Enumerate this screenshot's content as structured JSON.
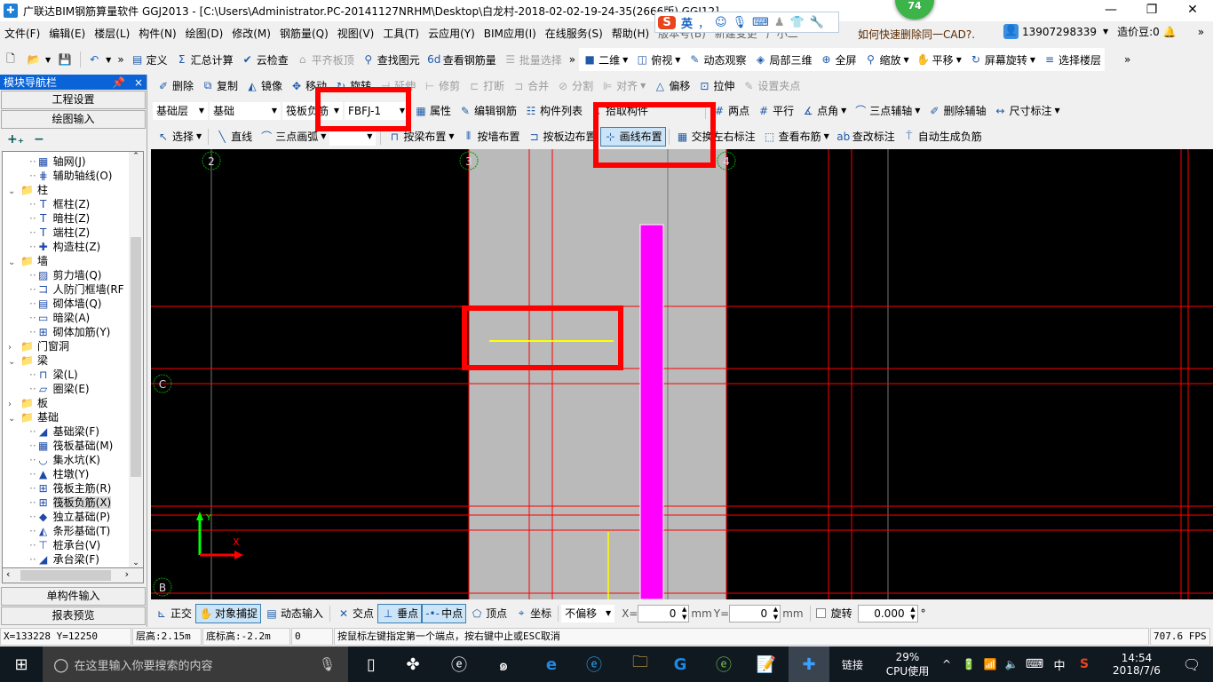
{
  "title": "广联达BIM钢筋算量软件 GGJ2013 - [C:\\Users\\Administrator.PC-20141127NRHM\\Desktop\\白龙村-2018-02-02-19-24-35(2666版).GGJ12]",
  "badge": "74",
  "ime": {
    "lang": "英",
    "punct": "，"
  },
  "menus": [
    "文件(F)",
    "编辑(E)",
    "楼层(L)",
    "构件(N)",
    "绘图(D)",
    "修改(M)",
    "钢筋量(Q)",
    "视图(V)",
    "工具(T)",
    "云应用(Y)",
    "BIM应用(I)",
    "在线服务(S)",
    "帮助(H)",
    "版本号(B)",
    "新建变更",
    "广小二"
  ],
  "tip": "如何快速删除同一CAD?.",
  "user": {
    "phone": "13907298339",
    "beans": "造价豆:0"
  },
  "toolbar1": [
    {
      "label": "定义",
      "icon": "▤"
    },
    {
      "label": "汇总计算",
      "icon": "Σ"
    },
    {
      "label": "云检查",
      "icon": "✔"
    },
    {
      "label": "平齐板顶",
      "icon": "⌂",
      "disabled": true
    },
    {
      "label": "查找图元",
      "icon": "⚲"
    },
    {
      "label": "查看钢筋量",
      "icon": "6d"
    },
    {
      "label": "批量选择",
      "icon": "☰",
      "disabled": true
    }
  ],
  "toolbar1b": [
    {
      "label": "二维",
      "icon": "■",
      "dropdown": true
    },
    {
      "label": "俯视",
      "icon": "◫",
      "dropdown": true
    },
    {
      "label": "动态观察",
      "icon": "✎"
    },
    {
      "label": "局部三维",
      "icon": "◈"
    },
    {
      "label": "全屏",
      "icon": "⊕"
    },
    {
      "label": "缩放",
      "icon": "⚲",
      "dropdown": true
    },
    {
      "label": "平移",
      "icon": "✋",
      "dropdown": true
    },
    {
      "label": "屏幕旋转",
      "icon": "↻",
      "dropdown": true
    },
    {
      "label": "选择楼层",
      "icon": "≡"
    }
  ],
  "toolbar2": [
    {
      "label": "删除",
      "icon": "✐"
    },
    {
      "label": "复制",
      "icon": "⧉"
    },
    {
      "label": "镜像",
      "icon": "◭"
    },
    {
      "label": "移动",
      "icon": "✥"
    },
    {
      "label": "旋转",
      "icon": "↻"
    },
    {
      "label": "延伸",
      "icon": "⊣",
      "disabled": true
    },
    {
      "label": "修剪",
      "icon": "⊢",
      "disabled": true
    },
    {
      "label": "打断",
      "icon": "⊏",
      "disabled": true
    },
    {
      "label": "合并",
      "icon": "⊐",
      "disabled": true
    },
    {
      "label": "分割",
      "icon": "⊘",
      "disabled": true
    },
    {
      "label": "对齐",
      "icon": "⊫",
      "disabled": true,
      "dropdown": true
    },
    {
      "label": "偏移",
      "icon": "△"
    },
    {
      "label": "拉伸",
      "icon": "⊡"
    },
    {
      "label": "设置夹点",
      "icon": "✎",
      "disabled": true
    }
  ],
  "selectors": {
    "floor": "基础层",
    "category": "基础",
    "type": "筏板负筋",
    "element": "FBFJ-1",
    "arc_mode": ""
  },
  "toolbar3": [
    {
      "label": "属性",
      "icon": "▦"
    },
    {
      "label": "编辑钢筋",
      "icon": "✎"
    },
    {
      "label": "构件列表",
      "icon": "☷"
    },
    {
      "label": "拾取构件",
      "icon": "↖"
    }
  ],
  "toolbar3b": [
    {
      "label": "两点",
      "icon": "#"
    },
    {
      "label": "平行",
      "icon": "#"
    },
    {
      "label": "点角",
      "icon": "∡",
      "dropdown": true
    },
    {
      "label": "三点辅轴",
      "icon": "⌒",
      "dropdown": true
    },
    {
      "label": "删除辅轴",
      "icon": "✐"
    },
    {
      "label": "尺寸标注",
      "icon": "↔",
      "dropdown": true
    }
  ],
  "toolbar4a": [
    {
      "label": "选择",
      "icon": "↖",
      "dropdown": true
    }
  ],
  "toolbar4b": [
    {
      "label": "直线",
      "icon": "╲"
    },
    {
      "label": "三点画弧",
      "icon": "⌒",
      "dropdown": true
    }
  ],
  "toolbar4c": [
    {
      "label": "按梁布置",
      "icon": "⊓",
      "dropdown": true
    },
    {
      "label": "按墙布置",
      "icon": "⫴"
    },
    {
      "label": "按板边布置",
      "icon": "⊐"
    },
    {
      "label": "画线布置",
      "icon": "⊹",
      "active": true
    }
  ],
  "toolbar4d": [
    {
      "label": "交换左右标注",
      "icon": "▦"
    },
    {
      "label": "查看布筋",
      "icon": "⬚",
      "dropdown": true
    },
    {
      "label": "查改标注",
      "icon": "ab"
    },
    {
      "label": "自动生成负筋",
      "icon": "⍑"
    }
  ],
  "nav": {
    "title": "模块导航栏",
    "pin": "ᵖ",
    "close": "×",
    "project_settings": "工程设置",
    "drawing_input": "绘图输入",
    "single_input": "单构件输入",
    "report_preview": "报表预览",
    "expand_all": "+₊",
    "collapse_all": "−"
  },
  "tree": [
    {
      "label": "轴网(J)",
      "level": 2,
      "icon": "▦"
    },
    {
      "label": "辅助轴线(O)",
      "level": 2,
      "icon": "⋕"
    },
    {
      "label": "柱",
      "level": 1,
      "expanded": true
    },
    {
      "label": "框柱(Z)",
      "level": 2,
      "icon": "T"
    },
    {
      "label": "暗柱(Z)",
      "level": 2,
      "icon": "T"
    },
    {
      "label": "端柱(Z)",
      "level": 2,
      "icon": "T"
    },
    {
      "label": "构造柱(Z)",
      "level": 2,
      "icon": "✚"
    },
    {
      "label": "墙",
      "level": 1,
      "expanded": true
    },
    {
      "label": "剪力墙(Q)",
      "level": 2,
      "icon": "▨"
    },
    {
      "label": "人防门框墙(RF",
      "level": 2,
      "icon": "コ"
    },
    {
      "label": "砌体墙(Q)",
      "level": 2,
      "icon": "▤"
    },
    {
      "label": "暗梁(A)",
      "level": 2,
      "icon": "▭"
    },
    {
      "label": "砌体加筋(Y)",
      "level": 2,
      "icon": "⊞"
    },
    {
      "label": "门窗洞",
      "level": 1,
      "expanded": false
    },
    {
      "label": "梁",
      "level": 1,
      "expanded": true
    },
    {
      "label": "梁(L)",
      "level": 2,
      "icon": "⊓"
    },
    {
      "label": "圈梁(E)",
      "level": 2,
      "icon": "▱"
    },
    {
      "label": "板",
      "level": 1,
      "expanded": false
    },
    {
      "label": "基础",
      "level": 1,
      "expanded": true
    },
    {
      "label": "基础梁(F)",
      "level": 2,
      "icon": "◢"
    },
    {
      "label": "筏板基础(M)",
      "level": 2,
      "icon": "▦"
    },
    {
      "label": "集水坑(K)",
      "level": 2,
      "icon": "◡"
    },
    {
      "label": "柱墩(Y)",
      "level": 2,
      "icon": "▲"
    },
    {
      "label": "筏板主筋(R)",
      "level": 2,
      "icon": "⊞"
    },
    {
      "label": "筏板负筋(X)",
      "level": 2,
      "icon": "⊞",
      "selected": true
    },
    {
      "label": "独立基础(P)",
      "level": 2,
      "icon": "◆"
    },
    {
      "label": "条形基础(T)",
      "level": 2,
      "icon": "◭"
    },
    {
      "label": "桩承台(V)",
      "level": 2,
      "icon": "⊤"
    },
    {
      "label": "承台梁(F)",
      "level": 2,
      "icon": "◢"
    }
  ],
  "canvas": {
    "axes": [
      {
        "label": "2"
      },
      {
        "label": "3"
      },
      {
        "label": "4"
      },
      {
        "label": "C"
      },
      {
        "label": "B"
      }
    ],
    "ucs": {
      "x": "X",
      "y": "Y"
    },
    "colors": {
      "background": "#000000",
      "slab": "#bababa",
      "gridline": "#ff0000",
      "rebar": "#ff00ff",
      "preview": "#ffff00",
      "highlight": "#ff0000",
      "axis_bubble": "#00aa00"
    }
  },
  "snap": [
    {
      "label": "正交",
      "icon": "⊾"
    },
    {
      "label": "对象捕捉",
      "icon": "✋",
      "active": true
    },
    {
      "label": "动态输入",
      "icon": "▤"
    }
  ],
  "snap2": [
    {
      "label": "交点",
      "icon": "✕"
    },
    {
      "label": "垂点",
      "icon": "⊥",
      "active": true
    },
    {
      "label": "中点",
      "icon": "-•-",
      "active": true
    },
    {
      "label": "顶点",
      "icon": "⬠"
    },
    {
      "label": "坐标",
      "icon": "⌖"
    }
  ],
  "offset": {
    "mode": "不偏移",
    "x_label": "X=",
    "x": "0",
    "y_label": "Y=",
    "y": "0",
    "unit": "mm",
    "rotate_label": "旋转",
    "rotate": "0.000",
    "deg": "°",
    "rotate_checked": false
  },
  "status": {
    "coords": "X=133228 Y=12250",
    "floor_height": "层高:2.15m",
    "bottom_elev": "底标高:-2.2m",
    "value": "0",
    "prompt": "按鼠标左键指定第一个端点，按右键中止或ESC取消",
    "fps": "707.6 FPS"
  },
  "taskbar": {
    "search_placeholder": "在这里输入你要搜索的内容",
    "link": "链接",
    "cpu": "29%",
    "cpu_label": "CPU使用",
    "ime": "中",
    "time": "14:54",
    "date": "2018/7/6"
  }
}
